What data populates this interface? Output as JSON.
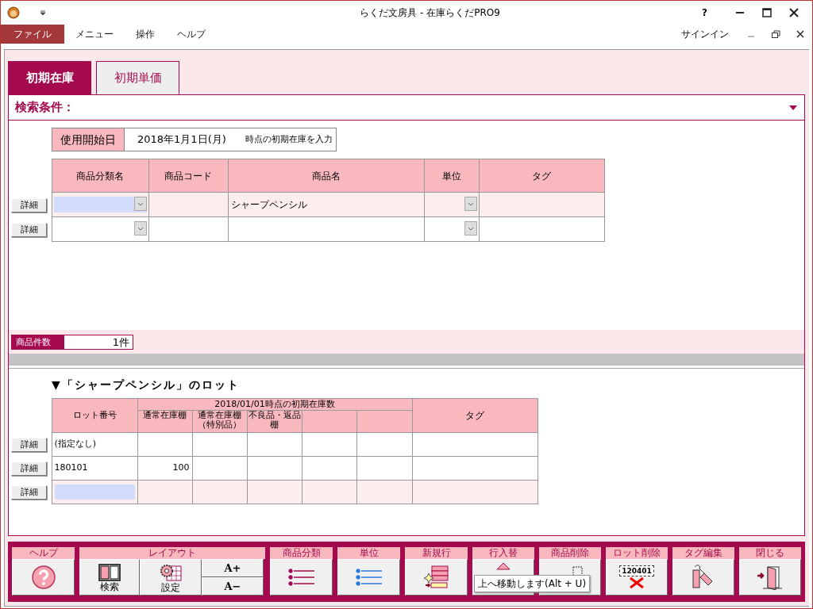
{
  "window": {
    "title": "らくだ文房具 - 在庫らくだPRO9",
    "help": "?"
  },
  "menu": [
    {
      "label": "ファイル",
      "selected": true
    },
    {
      "label": "メニュー",
      "selected": false
    },
    {
      "label": "操作",
      "selected": false
    },
    {
      "label": "ヘルプ",
      "selected": false
    }
  ],
  "account": {
    "sign_in": "サインイン"
  },
  "tabs": [
    {
      "label": "初期在庫",
      "selected": true
    },
    {
      "label": "初期単価",
      "selected": false
    }
  ],
  "search_panel": {
    "title": "検索条件：",
    "expanded": false
  },
  "start_date": {
    "label": "使用開始日",
    "value": "2018年1月1日(月)",
    "note": "時点の初期在庫を入力"
  },
  "products": {
    "columns": [
      "商品分類名",
      "商品コード",
      "商品名",
      "単位",
      "タグ"
    ],
    "rows": [
      {
        "detail": "詳細",
        "name": "シャープペンシル",
        "selected": true
      },
      {
        "detail": "詳細",
        "selected": false
      }
    ]
  },
  "count": {
    "label": "商品件数",
    "value": "1件"
  },
  "lots": {
    "title": "▼「シャープペンシル」のロット",
    "lot_column": "ロット番号",
    "stock_header": "2018/01/01時点の初期在庫数",
    "stock_columns": [
      {
        "label": "通常在庫棚"
      },
      {
        "label": "通常在庫棚（特別品）"
      },
      {
        "label": "不良品・返品棚"
      },
      {},
      {}
    ],
    "tag_column": "タグ",
    "rows": [
      {
        "detail": "詳細",
        "lot": "(指定なし)",
        "selected": false
      },
      {
        "detail": "詳細",
        "lot": "180101",
        "quantities": [
          "100"
        ],
        "selected": false
      },
      {
        "detail": "詳細",
        "selected": true
      }
    ]
  },
  "toolbar": [
    {
      "label": "ヘルプ",
      "buttons": [
        {
          "kind": "help"
        }
      ]
    },
    {
      "label": "レイアウト",
      "buttons": [
        {
          "kind": "panes",
          "text": "検索"
        },
        {
          "kind": "settings",
          "text": "設定"
        },
        {
          "kind": "font_size",
          "larger": "A+",
          "smaller": "A−"
        }
      ]
    },
    {
      "label": "商品分類",
      "buttons": [
        {
          "kind": "list_category"
        }
      ]
    },
    {
      "label": "単位",
      "buttons": [
        {
          "kind": "list_unit"
        }
      ]
    },
    {
      "label": "新規行",
      "buttons": [
        {
          "kind": "new_row"
        }
      ]
    },
    {
      "label": "行入替",
      "buttons": [
        {
          "kind": "move_up"
        }
      ]
    },
    {
      "label": "商品削除",
      "buttons": [
        {
          "kind": "delete_product"
        }
      ]
    },
    {
      "label": "ロット削除",
      "buttons": [
        {
          "kind": "delete_lot",
          "text": "120401"
        }
      ]
    },
    {
      "label": "タグ編集",
      "buttons": [
        {
          "kind": "tags"
        }
      ]
    },
    {
      "label": "閉じる",
      "buttons": [
        {
          "kind": "exit"
        }
      ]
    }
  ],
  "tooltip": "上へ移動します(Alt + U)"
}
